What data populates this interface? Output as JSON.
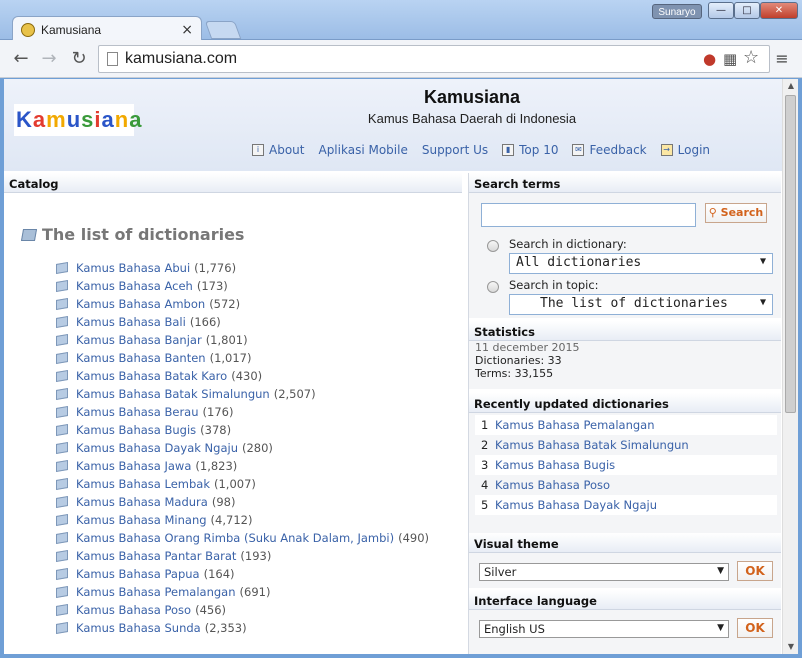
{
  "browser": {
    "tab_title": "Kamusiana",
    "tab_close": "×",
    "user_badge": "Sunaryo",
    "url": "kamusiana.com"
  },
  "header": {
    "logo_text": [
      "K",
      "a",
      "m",
      "u",
      "s",
      "i",
      "a",
      "n",
      "a"
    ],
    "logo_colors": [
      "#2a55c8",
      "#e33b2f",
      "#f2a900",
      "#2a55c8",
      "#3a9a3a",
      "#e33b2f",
      "#2a55c8",
      "#f2a900",
      "#3a9a3a"
    ],
    "title": "Kamusiana",
    "subtitle": "Kamus Bahasa Daerah di Indonesia",
    "nav": [
      {
        "label": "About",
        "icon": "info-icon"
      },
      {
        "label": "Aplikasi Mobile",
        "icon": ""
      },
      {
        "label": "Support Us",
        "icon": ""
      },
      {
        "label": "Top 10",
        "icon": "chart-icon"
      },
      {
        "label": "Feedback",
        "icon": "feedback-icon"
      },
      {
        "label": "Login",
        "icon": "login-icon"
      }
    ]
  },
  "catalog": {
    "heading": "Catalog",
    "list_title": "The list of dictionaries",
    "dictionaries": [
      {
        "name": "Kamus Bahasa Abui",
        "count": "(1,776)"
      },
      {
        "name": "Kamus Bahasa Aceh",
        "count": "(173)"
      },
      {
        "name": "Kamus Bahasa Ambon",
        "count": "(572)"
      },
      {
        "name": "Kamus Bahasa Bali",
        "count": "(166)"
      },
      {
        "name": "Kamus Bahasa Banjar",
        "count": "(1,801)"
      },
      {
        "name": "Kamus Bahasa Banten",
        "count": "(1,017)"
      },
      {
        "name": "Kamus Bahasa Batak Karo",
        "count": "(430)"
      },
      {
        "name": "Kamus Bahasa Batak Simalungun",
        "count": "(2,507)"
      },
      {
        "name": "Kamus Bahasa Berau",
        "count": "(176)"
      },
      {
        "name": "Kamus Bahasa Bugis",
        "count": "(378)"
      },
      {
        "name": "Kamus Bahasa Dayak Ngaju",
        "count": "(280)"
      },
      {
        "name": "Kamus Bahasa Jawa",
        "count": "(1,823)"
      },
      {
        "name": "Kamus Bahasa Lembak",
        "count": "(1,007)"
      },
      {
        "name": "Kamus Bahasa Madura",
        "count": "(98)"
      },
      {
        "name": "Kamus Bahasa Minang",
        "count": "(4,712)"
      },
      {
        "name": "Kamus Bahasa Orang Rimba (Suku Anak Dalam, Jambi)",
        "count": "(490)"
      },
      {
        "name": "Kamus Bahasa Pantar Barat",
        "count": "(193)"
      },
      {
        "name": "Kamus Bahasa Papua",
        "count": "(164)"
      },
      {
        "name": "Kamus Bahasa Pemalangan",
        "count": "(691)"
      },
      {
        "name": "Kamus Bahasa Poso",
        "count": "(456)"
      },
      {
        "name": "Kamus Bahasa Sunda",
        "count": "(2,353)"
      }
    ]
  },
  "search": {
    "heading": "Search terms",
    "input_value": "",
    "button_label": "Search",
    "in_dictionary_label": "Search in dictionary:",
    "dictionary_selected": "All dictionaries",
    "in_topic_label": "Search in topic:",
    "topic_selected": "The list of dictionaries"
  },
  "statistics": {
    "heading": "Statistics",
    "date": "11 december 2015",
    "dictionaries": "Dictionaries: 33",
    "terms": "Terms: 33,155"
  },
  "recent": {
    "heading": "Recently updated dictionaries",
    "items": [
      {
        "num": "1",
        "name": "Kamus Bahasa Pemalangan"
      },
      {
        "num": "2",
        "name": "Kamus Bahasa Batak Simalungun"
      },
      {
        "num": "3",
        "name": "Kamus Bahasa Bugis"
      },
      {
        "num": "4",
        "name": "Kamus Bahasa Poso"
      },
      {
        "num": "5",
        "name": "Kamus Bahasa Dayak Ngaju"
      }
    ]
  },
  "theme": {
    "heading": "Visual theme",
    "selected": "Silver",
    "ok_label": "OK"
  },
  "language": {
    "heading": "Interface language",
    "selected": "English US",
    "ok_label": "OK"
  }
}
